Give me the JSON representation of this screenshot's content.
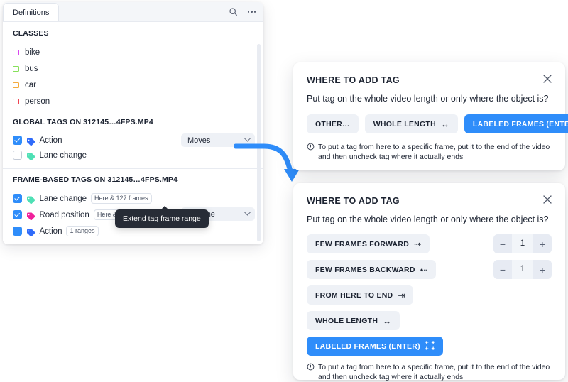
{
  "panel": {
    "tab_label": "Definitions",
    "search_icon": "search-icon",
    "more_icon": "more-options-icon",
    "classes_title": "CLASSES",
    "classes": [
      {
        "label": "bike",
        "color": "#d946ef"
      },
      {
        "label": "bus",
        "color": "#86e05a"
      },
      {
        "label": "car",
        "color": "#f5ab3d"
      },
      {
        "label": "person",
        "color": "#ef4352"
      }
    ],
    "global_tags_title": "GLOBAL TAGS ON 312145…4FPS.MP4",
    "global_tags": [
      {
        "name": "Action",
        "checked": "checked",
        "tag_color": "#2f6bfa",
        "value": "Moves"
      },
      {
        "name": "Lane change",
        "checked": "unchecked",
        "tag_color": "#4fe0b5",
        "value": ""
      }
    ],
    "frame_tags_title": "FRAME-BASED TAGS ON 312145…4FPS.MP4",
    "frame_tags": [
      {
        "name": "Lane change",
        "checked": "checked",
        "tag_color": "#4fe0b5",
        "badge": "Here & 127 frames",
        "value": ""
      },
      {
        "name": "Road position",
        "checked": "checked",
        "tag_color": "#f0219b",
        "badge": "Here & 557 fra…",
        "value": "Off-lane"
      },
      {
        "name": "Action",
        "checked": "partial",
        "tag_color": "#2f6bfa",
        "badge": "1 ranges",
        "value": ""
      }
    ],
    "row_icons": {
      "extend": "extend-frame-range-icon",
      "range": "left-right-arrow-icon"
    },
    "tooltip": "Extend tag frame range"
  },
  "dialog_top": {
    "title": "WHERE TO ADD TAG",
    "close_icon": "close-icon",
    "question": "Put tag on the whole video length or only where the object is?",
    "buttons": [
      {
        "label": "OTHER…",
        "glyph": "",
        "primary": false
      },
      {
        "label": "WHOLE LENGTH",
        "glyph": "↔",
        "primary": false
      },
      {
        "label": "LABELED FRAMES (ENTER)",
        "glyph": "⛶",
        "primary": true
      }
    ],
    "note_icon": "info-icon",
    "note": "To put a tag from here to a specific frame, put it to the end of the video and then uncheck tag where it actually ends"
  },
  "dialog_bottom": {
    "title": "WHERE TO ADD TAG",
    "close_icon": "close-icon",
    "question": "Put tag on the whole video length or only where the object is?",
    "options": [
      {
        "label": "FEW FRAMES FORWARD",
        "glyph": "⇢",
        "primary": false,
        "stepper": "1"
      },
      {
        "label": "FEW FRAMES BACKWARD",
        "glyph": "⇠",
        "primary": false,
        "stepper": "1"
      },
      {
        "label": "FROM HERE TO END",
        "glyph": "⇥",
        "primary": false,
        "stepper": ""
      },
      {
        "label": "WHOLE LENGTH",
        "glyph": "↔",
        "primary": false,
        "stepper": ""
      },
      {
        "label": "LABELED FRAMES (ENTER)",
        "glyph": "⛶",
        "primary": true,
        "stepper": ""
      }
    ],
    "stepper_minus": "−",
    "stepper_plus": "+",
    "note_icon": "info-icon",
    "note": "To put a tag from here to a specific frame, put it to the end of the video and then uncheck tag where it actually ends"
  },
  "annotation": {
    "arrow_color": "#2f8dfa",
    "arrow": "curved-arrow"
  }
}
